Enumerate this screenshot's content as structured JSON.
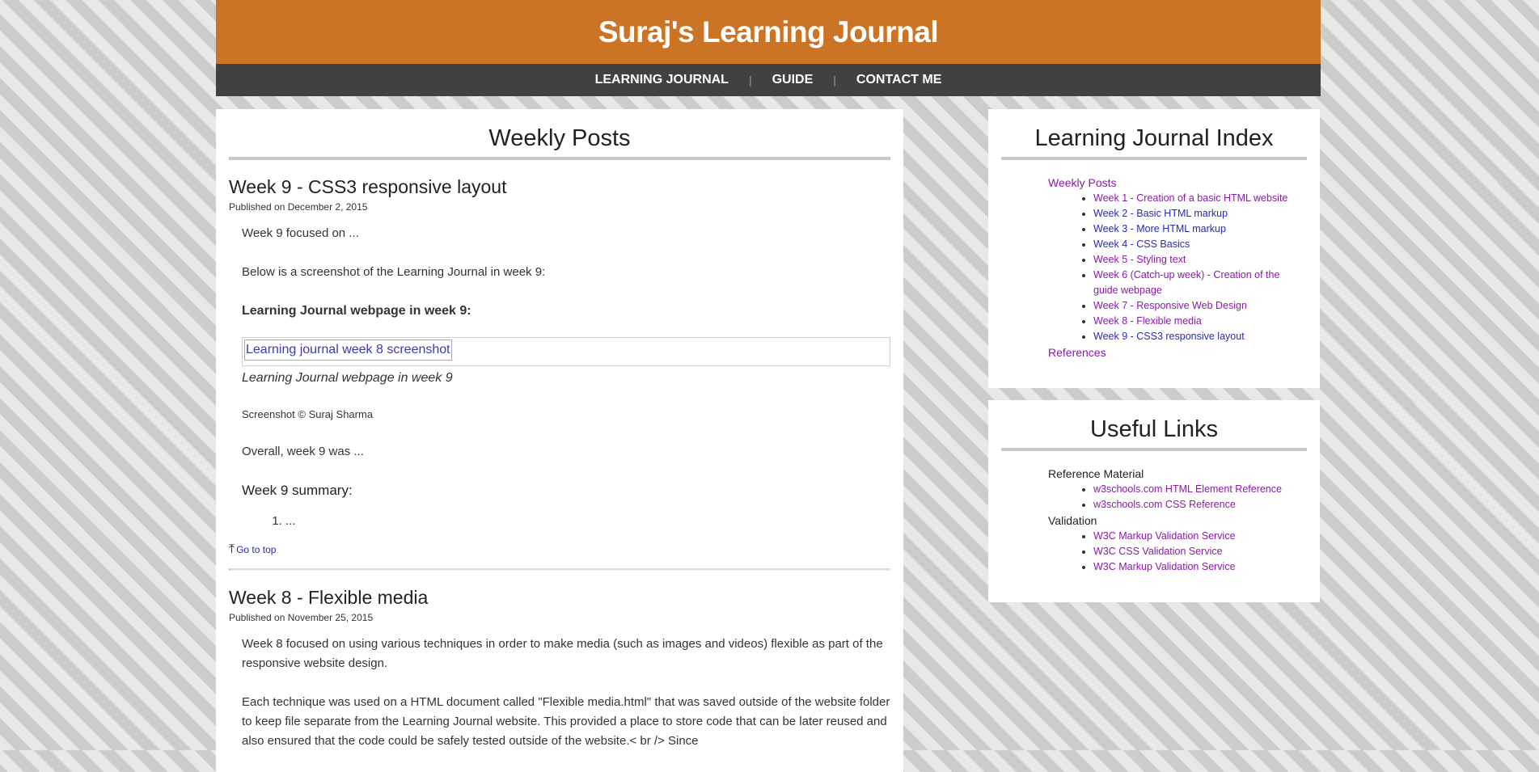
{
  "site": {
    "title": "Suraj's Learning Journal"
  },
  "nav": [
    {
      "label": "LEARNING JOURNAL"
    },
    {
      "label": "GUIDE"
    },
    {
      "label": "CONTACT ME"
    }
  ],
  "nav_separator": "|",
  "main": {
    "heading": "Weekly Posts",
    "week9": {
      "title": "Week 9 - CSS3 responsive layout",
      "date": "Published on December 2, 2015",
      "intro": "Week 9 focused on ...",
      "screenshot_line": "Below is a screenshot of the Learning Journal in week 9:",
      "subheading": "Learning Journal webpage in week 9:",
      "image_alt": "Learning journal week 8 screenshot",
      "caption": "Learning Journal webpage in week 9",
      "credit": "Screenshot © Suraj Sharma",
      "overall": "Overall, week 9 was ...",
      "summary_heading": "Week 9 summary:",
      "summary_items": [
        "..."
      ],
      "go_top": "Go to top"
    },
    "week8": {
      "title": "Week 8 - Flexible media",
      "date": "Published on November 25, 2015",
      "p1": "Week 8 focused on using various techniques in order to make media (such as images and videos) flexible as part of the responsive website design.",
      "p2": "Each technique was used on a HTML document called \"Flexible media.html\" that was saved outside of the website folder to keep file separate from the Learning Journal website. This provided a place to store code that can be later reused and also ensured that the code could be safely tested outside of the website.< br /> Since"
    }
  },
  "index": {
    "heading": "Learning Journal Index",
    "weekly_posts_label": "Weekly Posts",
    "items": [
      "Week 1 - Creation of a basic HTML website",
      "Week 2 - Basic HTML markup",
      "Week 3 - More HTML markup",
      "Week 4 - CSS Basics",
      "Week 5 - Styling text",
      "Week 6 (Catch-up week) - Creation of the guide webpage",
      "Week 7 - Responsive Web Design",
      "Week 8 - Flexible media",
      "Week 9 - CSS3 responsive layout"
    ],
    "references_label": "References"
  },
  "links": {
    "heading": "Useful Links",
    "reference_label": "Reference Material",
    "reference_items": [
      "w3schools.com HTML Element Reference",
      "w3schools.com CSS Reference"
    ],
    "validation_label": "Validation",
    "validation_items": [
      "W3C Markup Validation Service",
      "W3C CSS Validation Service",
      "W3C Markup Validation Service"
    ]
  },
  "colors": {
    "header": "#cc7425",
    "nav": "#414141",
    "visited_link": "#8a1aa8",
    "link": "#2a2ab0"
  }
}
